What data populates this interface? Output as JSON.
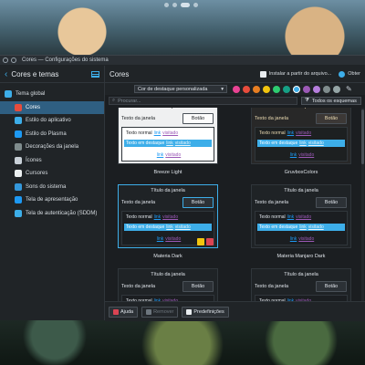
{
  "window": {
    "title": "Cores — Configurações do sistema"
  },
  "sidebar": {
    "title": "Cores e temas",
    "items": [
      {
        "label": "Tema global",
        "level": "parent",
        "icon": "global-theme-icon",
        "color": "#3daee9"
      },
      {
        "label": "Cores",
        "level": "child",
        "icon": "palette-icon",
        "color": "#e74c3c",
        "selected": true
      },
      {
        "label": "Estilo do aplicativo",
        "level": "child",
        "icon": "app-style-icon",
        "color": "#3daee9"
      },
      {
        "label": "Estilo do Plasma",
        "level": "child",
        "icon": "plasma-icon",
        "color": "#1d99f3"
      },
      {
        "label": "Decorações da janela",
        "level": "child",
        "icon": "window-decoration-icon",
        "color": "#7f8c8d"
      },
      {
        "label": "Ícones",
        "level": "child",
        "icon": "icons-icon",
        "color": "#c9d1d8"
      },
      {
        "label": "Cursores",
        "level": "child",
        "icon": "cursor-icon",
        "color": "#ecf0f1"
      },
      {
        "label": "Sons do sistema",
        "level": "child",
        "icon": "sound-icon",
        "color": "#3498db"
      },
      {
        "label": "Tela de apresentação",
        "level": "child",
        "icon": "splash-icon",
        "color": "#1d99f3"
      },
      {
        "label": "Tela de autenticação (SDDM)",
        "level": "child",
        "icon": "login-icon",
        "color": "#3daee9"
      }
    ]
  },
  "header": {
    "title": "Cores",
    "install_label": "Instalar a partir do arquivo...",
    "get_new_label": "Obter"
  },
  "accent": {
    "selected": "Cor de destaque personalizada",
    "colors": [
      "#e84393",
      "#e74c3c",
      "#e67e22",
      "#f1c40f",
      "#2ecc71",
      "#16a085",
      "#3daee9",
      "#9b59b6",
      "#b57edc",
      "#7f8c8d",
      "#95a5a6"
    ],
    "selected_index": 6
  },
  "search": {
    "placeholder": "Procurar...",
    "filter_label": "Todos os esquemas"
  },
  "preview": {
    "window_title": "Título da janela",
    "window_text": "Texto da janela",
    "button": "Botão",
    "normal_text": "Texto normal",
    "link": "link",
    "visited": "visitado",
    "selected_text": "Texto em destaque",
    "disabled_text": "Texto desativado"
  },
  "schemes": [
    {
      "name": "Breeze Light",
      "bg": "#eff0f1",
      "fg": "#232629",
      "view": "#ffffff",
      "btn": "#fcfcfc"
    },
    {
      "name": "GruvboxColors",
      "bg": "#282828",
      "fg": "#ebdbb2",
      "view": "#1d2021",
      "btn": "#3c3836"
    },
    {
      "name": "Materia Dark",
      "bg": "#1f2326",
      "fg": "#dfe4ea",
      "view": "#1b1e21",
      "btn": "#2c3136",
      "selected": true
    },
    {
      "name": "Materia Manjaro Dark",
      "bg": "#1f2326",
      "fg": "#dfe4ea",
      "view": "#1b1e21",
      "btn": "#2c3136"
    },
    {
      "name": "",
      "bg": "#1f2326",
      "fg": "#dfe4ea",
      "view": "#1b1e21",
      "btn": "#2c3136"
    },
    {
      "name": "",
      "bg": "#1f2326",
      "fg": "#dfe4ea",
      "view": "#1b1e21",
      "btn": "#2c3136"
    }
  ],
  "footer": {
    "help": "Ajuda",
    "remove": "Remover",
    "defaults": "Predefinições"
  }
}
